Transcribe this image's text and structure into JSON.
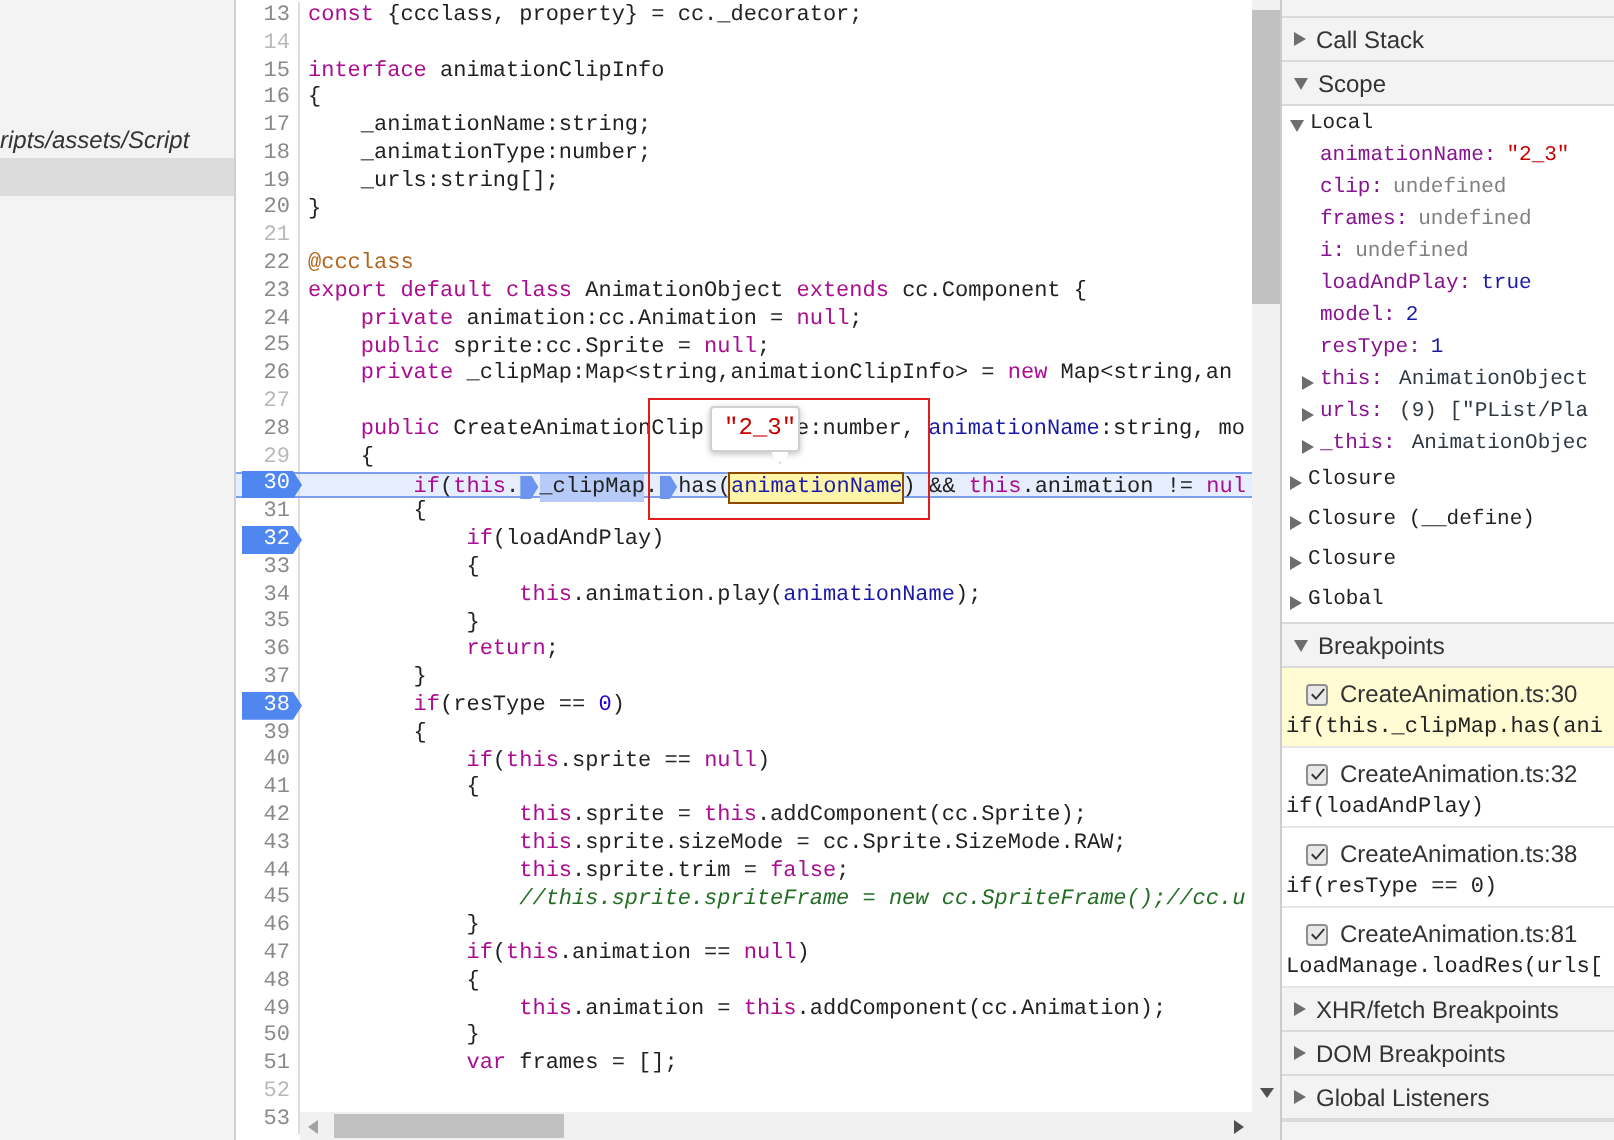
{
  "navigator": {
    "path_label": "ripts/assets/Script",
    "selected_row": true
  },
  "editor": {
    "lines": [
      {
        "number": "13",
        "breakpoint": false,
        "muted": false,
        "current": false,
        "segments": [
          {
            "kind": "kw",
            "text": "const"
          },
          {
            "kind": "plain",
            "text": " {ccclass, property} = cc._decorator;"
          }
        ]
      },
      {
        "number": "14",
        "breakpoint": false,
        "muted": true,
        "current": false
      },
      {
        "number": "15",
        "breakpoint": false,
        "muted": false,
        "current": false,
        "segments": [
          {
            "kind": "kw",
            "text": "interface"
          },
          {
            "kind": "plain",
            "text": " animationClipInfo"
          }
        ]
      },
      {
        "number": "16",
        "breakpoint": false,
        "muted": false,
        "current": false,
        "segments": [
          {
            "kind": "plain",
            "text": "{"
          }
        ]
      },
      {
        "number": "17",
        "breakpoint": false,
        "muted": false,
        "current": false,
        "segments": [
          {
            "kind": "plain",
            "text": "    _animationName:string;"
          }
        ]
      },
      {
        "number": "18",
        "breakpoint": false,
        "muted": false,
        "current": false,
        "segments": [
          {
            "kind": "plain",
            "text": "    _animationType:number;"
          }
        ]
      },
      {
        "number": "19",
        "breakpoint": false,
        "muted": false,
        "current": false,
        "segments": [
          {
            "kind": "plain",
            "text": "    _urls:string[];"
          }
        ]
      },
      {
        "number": "20",
        "breakpoint": false,
        "muted": false,
        "current": false,
        "segments": [
          {
            "kind": "plain",
            "text": "}"
          }
        ]
      },
      {
        "number": "21",
        "breakpoint": false,
        "muted": true,
        "current": false
      },
      {
        "number": "22",
        "breakpoint": false,
        "muted": false,
        "current": false,
        "segments": [
          {
            "kind": "deco",
            "text": "@ccclass"
          }
        ]
      },
      {
        "number": "23",
        "breakpoint": false,
        "muted": false,
        "current": false,
        "segments": [
          {
            "kind": "kw",
            "text": "export"
          },
          {
            "kind": "kw",
            "text": " default"
          },
          {
            "kind": "kw",
            "text": " class"
          },
          {
            "kind": "plain",
            "text": " AnimationObject"
          },
          {
            "kind": "kw",
            "text": " extends"
          },
          {
            "kind": "plain",
            "text": " cc.Component {"
          }
        ]
      },
      {
        "number": "24",
        "breakpoint": false,
        "muted": false,
        "current": false,
        "segments": [
          {
            "kind": "kw",
            "text": "    private"
          },
          {
            "kind": "plain",
            "text": " animation:cc.Animation = "
          },
          {
            "kind": "kw",
            "text": "null"
          },
          {
            "kind": "plain",
            "text": ";"
          }
        ]
      },
      {
        "number": "25",
        "breakpoint": false,
        "muted": false,
        "current": false,
        "segments": [
          {
            "kind": "kw",
            "text": "    public"
          },
          {
            "kind": "plain",
            "text": " sprite:cc.Sprite = "
          },
          {
            "kind": "kw",
            "text": "null"
          },
          {
            "kind": "plain",
            "text": ";"
          }
        ]
      },
      {
        "number": "26",
        "breakpoint": false,
        "muted": false,
        "current": false,
        "segments": [
          {
            "kind": "kw",
            "text": "    private"
          },
          {
            "kind": "plain",
            "text": " _clipMap:Map<string,animationClipInfo> = "
          },
          {
            "kind": "kw",
            "text": "new"
          },
          {
            "kind": "plain",
            "text": " Map<string,an"
          }
        ]
      },
      {
        "number": "27",
        "breakpoint": false,
        "muted": true,
        "current": false
      },
      {
        "number": "28",
        "breakpoint": false,
        "muted": false,
        "current": false,
        "segments": [
          {
            "kind": "kw",
            "text": "    public"
          },
          {
            "kind": "plain",
            "text": " CreateAnimationClip"
          },
          {
            "kind": "tooltip",
            "text": "\"2_3\""
          },
          {
            "kind": "plain",
            "text": "e:number, "
          },
          {
            "kind": "var",
            "text": "animationName"
          },
          {
            "kind": "plain",
            "text": ":string, mo"
          }
        ]
      },
      {
        "number": "29",
        "breakpoint": false,
        "muted": true,
        "current": false,
        "segments": [
          {
            "kind": "plain",
            "text": "    {"
          }
        ]
      },
      {
        "number": "30",
        "breakpoint": true,
        "muted": false,
        "current": true,
        "segments": [
          {
            "kind": "kw",
            "text": "        if"
          },
          {
            "kind": "plain",
            "text": "("
          },
          {
            "kind": "kw",
            "text": "this"
          },
          {
            "kind": "plain",
            "text": "."
          },
          {
            "kind": "marker"
          },
          {
            "kind": "hl",
            "text": "_clipMap"
          },
          {
            "kind": "plain",
            "text": "."
          },
          {
            "kind": "marker"
          },
          {
            "kind": "plain",
            "text": "has("
          },
          {
            "kind": "hover",
            "text": "animationName"
          },
          {
            "kind": "plain",
            "text": ") && "
          },
          {
            "kind": "kw",
            "text": "this"
          },
          {
            "kind": "plain",
            "text": ".animation != "
          },
          {
            "kind": "kw",
            "text": "nul"
          }
        ]
      },
      {
        "number": "31",
        "breakpoint": false,
        "muted": false,
        "current": false,
        "segments": [
          {
            "kind": "plain",
            "text": "        {"
          }
        ]
      },
      {
        "number": "32",
        "breakpoint": true,
        "muted": false,
        "current": false,
        "segments": [
          {
            "kind": "kw",
            "text": "            if"
          },
          {
            "kind": "plain",
            "text": "(loadAndPlay)"
          }
        ]
      },
      {
        "number": "33",
        "breakpoint": false,
        "muted": false,
        "current": false,
        "segments": [
          {
            "kind": "plain",
            "text": "            {"
          }
        ]
      },
      {
        "number": "34",
        "breakpoint": false,
        "muted": false,
        "current": false,
        "segments": [
          {
            "kind": "kw",
            "text": "                this"
          },
          {
            "kind": "plain",
            "text": ".animation.play("
          },
          {
            "kind": "var",
            "text": "animationName"
          },
          {
            "kind": "plain",
            "text": ");"
          }
        ]
      },
      {
        "number": "35",
        "breakpoint": false,
        "muted": false,
        "current": false,
        "segments": [
          {
            "kind": "plain",
            "text": "            }"
          }
        ]
      },
      {
        "number": "36",
        "breakpoint": false,
        "muted": false,
        "current": false,
        "segments": [
          {
            "kind": "kw",
            "text": "            return"
          },
          {
            "kind": "plain",
            "text": ";"
          }
        ]
      },
      {
        "number": "37",
        "breakpoint": false,
        "muted": false,
        "current": false,
        "segments": [
          {
            "kind": "plain",
            "text": "        }"
          }
        ]
      },
      {
        "number": "38",
        "breakpoint": true,
        "muted": false,
        "current": false,
        "segments": [
          {
            "kind": "kw",
            "text": "        if"
          },
          {
            "kind": "plain",
            "text": "(resType == "
          },
          {
            "kind": "num",
            "text": "0"
          },
          {
            "kind": "plain",
            "text": ")"
          }
        ]
      },
      {
        "number": "39",
        "breakpoint": false,
        "muted": false,
        "current": false,
        "segments": [
          {
            "kind": "plain",
            "text": "        {"
          }
        ]
      },
      {
        "number": "40",
        "breakpoint": false,
        "muted": false,
        "current": false,
        "segments": [
          {
            "kind": "kw",
            "text": "            if"
          },
          {
            "kind": "plain",
            "text": "("
          },
          {
            "kind": "kw",
            "text": "this"
          },
          {
            "kind": "plain",
            "text": ".sprite == "
          },
          {
            "kind": "kw",
            "text": "null"
          },
          {
            "kind": "plain",
            "text": ")"
          }
        ]
      },
      {
        "number": "41",
        "breakpoint": false,
        "muted": false,
        "current": false,
        "segments": [
          {
            "kind": "plain",
            "text": "            {"
          }
        ]
      },
      {
        "number": "42",
        "breakpoint": false,
        "muted": false,
        "current": false,
        "segments": [
          {
            "kind": "kw",
            "text": "                this"
          },
          {
            "kind": "plain",
            "text": ".sprite = "
          },
          {
            "kind": "kw",
            "text": "this"
          },
          {
            "kind": "plain",
            "text": ".addComponent(cc.Sprite);"
          }
        ]
      },
      {
        "number": "43",
        "breakpoint": false,
        "muted": false,
        "current": false,
        "segments": [
          {
            "kind": "kw",
            "text": "                this"
          },
          {
            "kind": "plain",
            "text": ".sprite.sizeMode = cc.Sprite.SizeMode.RAW;"
          }
        ]
      },
      {
        "number": "44",
        "breakpoint": false,
        "muted": false,
        "current": false,
        "segments": [
          {
            "kind": "kw",
            "text": "                this"
          },
          {
            "kind": "plain",
            "text": ".sprite.trim = "
          },
          {
            "kind": "kw",
            "text": "false"
          },
          {
            "kind": "plain",
            "text": ";"
          }
        ]
      },
      {
        "number": "45",
        "breakpoint": false,
        "muted": false,
        "current": false,
        "segments": [
          {
            "kind": "comment",
            "text": "                //this.sprite.spriteFrame = new cc.SpriteFrame();//cc.u"
          }
        ]
      },
      {
        "number": "46",
        "breakpoint": false,
        "muted": false,
        "current": false,
        "segments": [
          {
            "kind": "plain",
            "text": "            }"
          }
        ]
      },
      {
        "number": "47",
        "breakpoint": false,
        "muted": false,
        "current": false,
        "segments": [
          {
            "kind": "kw",
            "text": "            if"
          },
          {
            "kind": "plain",
            "text": "("
          },
          {
            "kind": "kw",
            "text": "this"
          },
          {
            "kind": "plain",
            "text": ".animation == "
          },
          {
            "kind": "kw",
            "text": "null"
          },
          {
            "kind": "plain",
            "text": ")"
          }
        ]
      },
      {
        "number": "48",
        "breakpoint": false,
        "muted": false,
        "current": false,
        "segments": [
          {
            "kind": "plain",
            "text": "            {"
          }
        ]
      },
      {
        "number": "49",
        "breakpoint": false,
        "muted": false,
        "current": false,
        "segments": [
          {
            "kind": "kw",
            "text": "                this"
          },
          {
            "kind": "plain",
            "text": ".animation = "
          },
          {
            "kind": "kw",
            "text": "this"
          },
          {
            "kind": "plain",
            "text": ".addComponent(cc.Animation);"
          }
        ]
      },
      {
        "number": "50",
        "breakpoint": false,
        "muted": false,
        "current": false,
        "segments": [
          {
            "kind": "plain",
            "text": "            }"
          }
        ]
      },
      {
        "number": "51",
        "breakpoint": false,
        "muted": false,
        "current": false,
        "segments": [
          {
            "kind": "kw",
            "text": "            var"
          },
          {
            "kind": "plain",
            "text": " frames = [];"
          }
        ]
      },
      {
        "number": "52",
        "breakpoint": false,
        "muted": true,
        "current": false
      },
      {
        "number": "53",
        "breakpoint": false,
        "muted": false,
        "current": false
      }
    ]
  },
  "sidebar": {
    "sections": [
      {
        "title": "Call Stack",
        "expanded": false
      },
      {
        "title": "Scope",
        "expanded": true,
        "scope_tree": [
          {
            "label": "Local",
            "expanded": true,
            "children": [
              {
                "label": "animationName:",
                "value": "\"2_3\"",
                "kind": "string"
              },
              {
                "label": "clip:",
                "value": "undefined",
                "kind": "undefined"
              },
              {
                "label": "frames:",
                "value": "undefined",
                "kind": "undefined"
              },
              {
                "label": "i:",
                "value": "undefined",
                "kind": "undefined"
              },
              {
                "label": "loadAndPlay:",
                "value": "true",
                "kind": "primitive"
              },
              {
                "label": "model:",
                "value": "2",
                "kind": "primitive"
              },
              {
                "label": "resType:",
                "value": "1",
                "kind": "primitive"
              },
              {
                "label": "this:",
                "value": "AnimationObject",
                "kind": "object",
                "expanded": false
              },
              {
                "label": "urls:",
                "value": "(9) [\"PList/Pla",
                "kind": "object",
                "expanded": false
              },
              {
                "label": "_this:",
                "value": "AnimationObjec",
                "kind": "object",
                "expanded": false
              }
            ]
          },
          {
            "label": "Closure",
            "expanded": false
          },
          {
            "label": "Closure (__define)",
            "expanded": false
          },
          {
            "label": "Closure",
            "expanded": false
          },
          {
            "label": "Global",
            "expanded": false
          }
        ]
      },
      {
        "title": "Breakpoints",
        "expanded": true,
        "breakpoints": [
          {
            "location": "CreateAnimation.ts:30",
            "code": "if(this._clipMap.has(ani",
            "checked": true,
            "active": true
          },
          {
            "location": "CreateAnimation.ts:32",
            "code": "if(loadAndPlay)",
            "checked": true,
            "active": false
          },
          {
            "location": "CreateAnimation.ts:38",
            "code": "if(resType == 0)",
            "checked": true,
            "active": false
          },
          {
            "location": "CreateAnimation.ts:81",
            "code": "LoadManage.loadRes(urls[",
            "checked": true,
            "active": false
          }
        ]
      },
      {
        "title": "XHR/fetch Breakpoints",
        "expanded": false
      },
      {
        "title": "DOM Breakpoints",
        "expanded": false
      },
      {
        "title": "Global Listeners",
        "expanded": false
      }
    ]
  }
}
